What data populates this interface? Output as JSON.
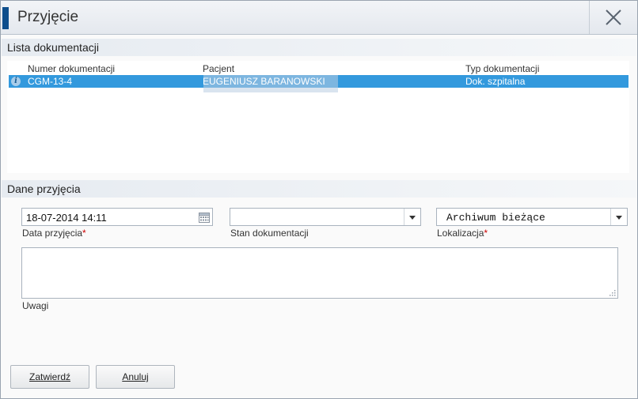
{
  "window": {
    "title": "Przyjęcie"
  },
  "documents": {
    "section_title": "Lista dokumentacji",
    "columns": [
      "Numer dokumentacji",
      "Pacjent",
      "Typ dokumentacji"
    ],
    "rows": [
      {
        "number": "CGM-13-4",
        "patient": "EUGENIUSZ BARANOWSKI",
        "type": "Dok. szpitalna"
      }
    ]
  },
  "admission": {
    "section_title": "Dane przyjęcia",
    "date": {
      "value": "18-07-2014 14:11",
      "label": "Data przyjęcia",
      "required_mark": "*"
    },
    "status": {
      "value": "",
      "label": "Stan dokumentacji"
    },
    "location": {
      "value": "Archiwum bieżące",
      "label": "Lokalizacja",
      "required_mark": "*"
    },
    "notes": {
      "value": "",
      "label": "Uwagi"
    }
  },
  "buttons": {
    "confirm": "Zatwierdź",
    "cancel": "Anuluj"
  },
  "colors": {
    "accent": "#0e4e8c",
    "selection": "#3399dd",
    "required": "#cc0000"
  }
}
